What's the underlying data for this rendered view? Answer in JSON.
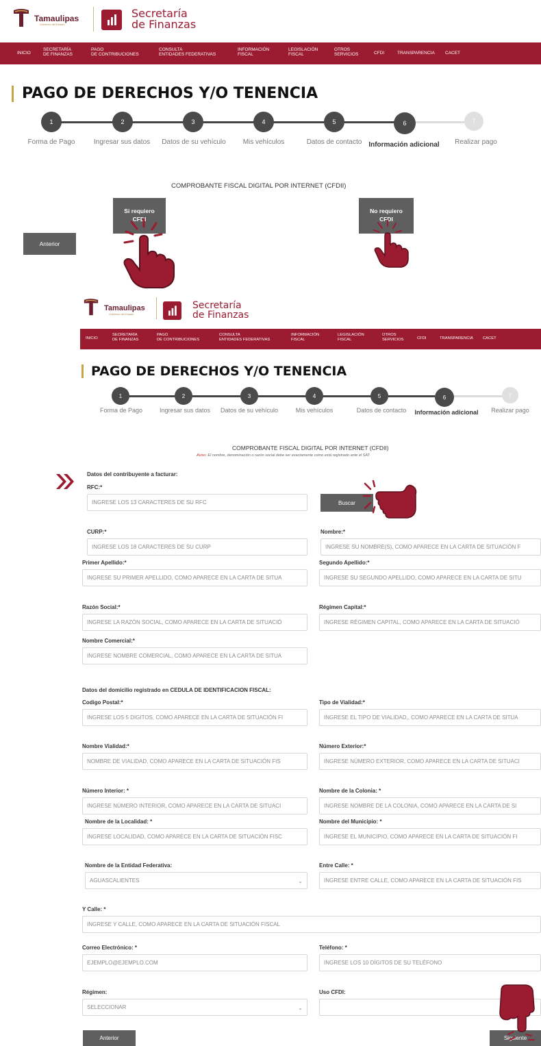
{
  "brand": {
    "state": "Tamaulipas",
    "state_sub": "Gobierno del Estado",
    "secretaria_line1": "Secretaría",
    "secretaria_line2": "de Finanzas"
  },
  "nav": [
    "INICIO",
    "SECRETARÍA\nDE FINANZAS",
    "PAGO\nDE CONTRIBUCIONES",
    "CONSULTA\nENTIDADES FEDERATIVAS",
    "INFORMACIÓN\nFISCAL",
    "LEGISLACIÓN\nFISCAL",
    "OTROS\nSERVICIOS",
    "CFDI",
    "TRANSPARENCIA",
    "CACET"
  ],
  "page_title": "PAGO DE DERECHOS Y/O TENENCIA",
  "steps": [
    {
      "num": "1",
      "label": "Forma de Pago"
    },
    {
      "num": "2",
      "label": "Ingresar sus datos"
    },
    {
      "num": "3",
      "label": "Datos de su vehículo"
    },
    {
      "num": "4",
      "label": "Mis vehículos"
    },
    {
      "num": "5",
      "label": "Datos de contacto"
    },
    {
      "num": "6",
      "label": "Información adicional"
    },
    {
      "num": "7",
      "label": "Realizar pago"
    }
  ],
  "cfdi_title": "COMPROBANTE FISCAL DIGITAL POR INTERNET (CFDII)",
  "choice": {
    "si": "Si requiero\nCFDI",
    "no": "No requiero\nCFDI",
    "anterior": "Anterior"
  },
  "notice": {
    "prefix": "Aviso:",
    "text": " El nombre, denominación o razón social debe ser exactamente como está registrado ante el SAT"
  },
  "form": {
    "section_contribuyente": "Datos del contribuyente a facturar:",
    "rfc": {
      "label": "RFC:*",
      "placeholder": "INGRESE LOS 13 CARACTERES DE SU RFC"
    },
    "buscar": "Buscar",
    "curp": {
      "label": "CURP:*",
      "placeholder": "INGRESE LOS 18 CARACTERES DE SU CURP"
    },
    "nombre": {
      "label": "Nombre:*",
      "placeholder": "INGRESE SU NOMBRE(S), COMO APARECE EN LA CARTA DE SITUACIÓN F"
    },
    "primer_apellido": {
      "label": "Primer Apellido:*",
      "placeholder": "INGRESE SU PRIMER APELLIDO, COMO APARECE EN LA CARTA DE SITUA"
    },
    "segundo_apellido": {
      "label": "Segundo Apellido:*",
      "placeholder": "INGRESE SU SEGUNDO APELLIDO, COMO APARECE EN LA CARTA DE SITU"
    },
    "razon_social": {
      "label": "Razón Social:*",
      "placeholder": "INGRESE LA RAZÓN SOCIAL, COMO APARECE EN LA CARTA DE SITUACIÓ"
    },
    "regimen_capital": {
      "label": "Régimen Capital:*",
      "placeholder": "INGRESE RÉGIMEN CAPITAL, COMO APARECE EN LA CARTA DE SITUACIÓ"
    },
    "nombre_comercial": {
      "label": "Nombre Comercial:*",
      "placeholder": "INGRESE NOMBRE COMERCIAL, COMO APARECE EN LA CARTA DE SITUA"
    },
    "section_domicilio": "Datos del domicilio registrado en CEDULA DE IDENTIFICACION FISCAL:",
    "codigo_postal": {
      "label": "Codigo Postal:*",
      "placeholder": "INGRESE LOS 5 DIGITOS, COMO APARECE EN LA CARTA DE SITUACIÓN FI"
    },
    "tipo_vialidad": {
      "label": "Tipo de Vialidad:*",
      "placeholder": "INGRESE EL TIPO DE VIALIDAD,, COMO APARECE EN LA CARTA DE SITUA"
    },
    "nombre_vialidad": {
      "label": "Nombre Vialidad:*",
      "placeholder": "NOMBRE DE VIALIDAD, COMO APARECE EN LA CARTA DE SITUACIÓN FIS"
    },
    "numero_exterior": {
      "label": "Número Exterior:*",
      "placeholder": "INGRESE NÚMERO EXTERIOR, COMO APARECE EN LA CARTA DE SITUACI"
    },
    "numero_interior": {
      "label": "Número Interior: *",
      "placeholder": "INGRESE NÚMERO INTERIOR, COMO APARECE EN LA CARTA DE SITUACI"
    },
    "nombre_colonia": {
      "label": "Nombre de la Colonia: *",
      "placeholder": "INGRESE NOMBRE DE LA COLONIA, COMO APARECE EN LA CARTA DE SI"
    },
    "nombre_localidad": {
      "label": "Nombre de la Localidad: *",
      "placeholder": "INGRESE LOCALIDAD, COMO APARECE EN LA CARTA DE SITUACIÓN FISC"
    },
    "nombre_municipio": {
      "label": "Nombre del Municipio: *",
      "placeholder": "INGRESE EL MUNICIPIO, COMO APARECE EN LA CARTA DE SITUACIÓN FI"
    },
    "entidad_federativa": {
      "label": "Nombre de la Entidad Federativa:",
      "value": "AGUASCALIENTES"
    },
    "entre_calle": {
      "label": "Entre Calle: *",
      "placeholder": "INGRESE ENTRE CALLE, COMO APARECE EN LA CARTA DE SITUACIÓN FIS"
    },
    "y_calle": {
      "label": "Y Calle: *",
      "placeholder": "INGRESE Y CALLE, COMO APARECE EN LA CARTA DE SITUACIÓN FISCAL"
    },
    "correo": {
      "label": "Correo Electrónico: *",
      "placeholder": "EJEMPLO@EJEMPLO.COM"
    },
    "telefono": {
      "label": "Teléfono: *",
      "placeholder": "INGRESE LOS 10 DÍGITOS DE SU TELÉFONO"
    },
    "regimen": {
      "label": "Régimen:",
      "value": "SELECCIONAR"
    },
    "uso_cfdi": {
      "label": "Uso CFDI:",
      "value": ""
    },
    "anterior": "Anterior",
    "siguiente": "Siguiente"
  },
  "colors": {
    "brand": "#9b1b30",
    "gold": "#c9a447",
    "step_active": "#4a4a4a",
    "step_inactive": "#e0e0e0"
  },
  "icons": [
    "tamaulipas-logo-icon",
    "bar-chart-logo-icon",
    "pointing-hand-icon",
    "double-chevron-icon"
  ]
}
